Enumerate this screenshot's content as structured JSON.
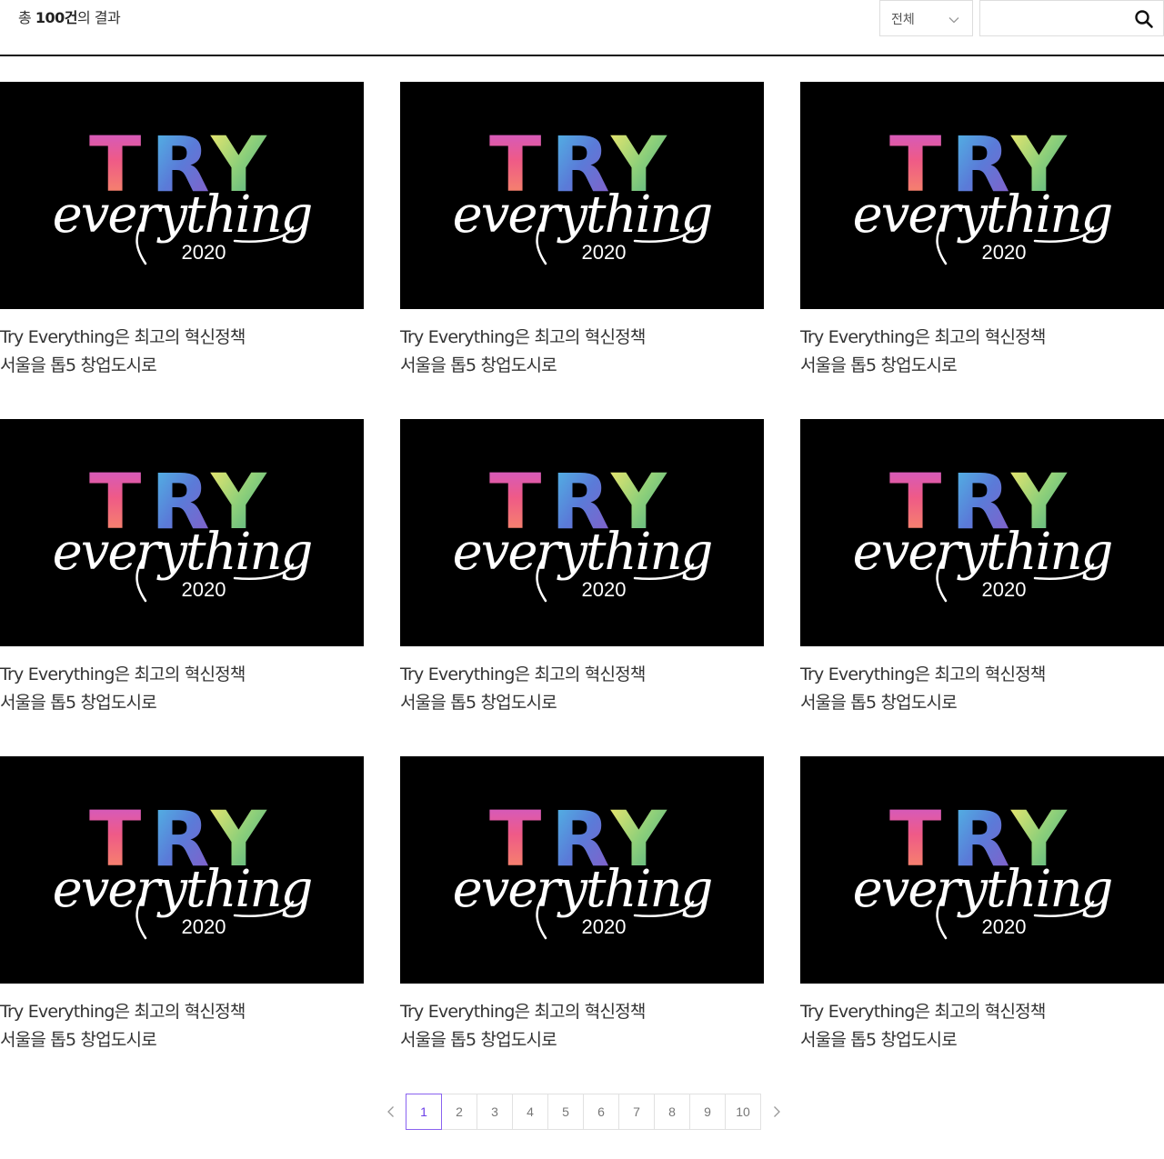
{
  "result": {
    "prefix": "총 ",
    "count": "100건",
    "suffix": "의 결과"
  },
  "filter": {
    "selected": "전체"
  },
  "search": {
    "placeholder": "",
    "value": ""
  },
  "thumbnail": {
    "top_word": "TRY",
    "script_word": "everything",
    "year": "2020"
  },
  "cards": [
    {
      "line1": "Try Everything은 최고의 혁신정책",
      "line2": "서울을 톱5 창업도시로"
    },
    {
      "line1": "Try Everything은 최고의 혁신정책",
      "line2": "서울을 톱5 창업도시로"
    },
    {
      "line1": "Try Everything은 최고의 혁신정책",
      "line2": "서울을 톱5 창업도시로"
    },
    {
      "line1": "Try Everything은 최고의 혁신정책",
      "line2": "서울을 톱5 창업도시로"
    },
    {
      "line1": "Try Everything은 최고의 혁신정책",
      "line2": "서울을 톱5 창업도시로"
    },
    {
      "line1": "Try Everything은 최고의 혁신정책",
      "line2": "서울을 톱5 창업도시로"
    },
    {
      "line1": "Try Everything은 최고의 혁신정책",
      "line2": "서울을 톱5 창업도시로"
    },
    {
      "line1": "Try Everything은 최고의 혁신정책",
      "line2": "서울을 톱5 창업도시로"
    },
    {
      "line1": "Try Everything은 최고의 혁신정책",
      "line2": "서울을 톱5 창업도시로"
    }
  ],
  "pagination": {
    "pages": [
      "1",
      "2",
      "3",
      "4",
      "5",
      "6",
      "7",
      "8",
      "9",
      "10"
    ],
    "current": "1"
  },
  "colors": {
    "accent": "#6c3fe8",
    "divider": "#111111",
    "thumb_bg": "#000000"
  },
  "icons": {
    "filter": "chevron-down-icon",
    "search": "search-icon",
    "prev": "chevron-left-icon",
    "next": "chevron-right-icon"
  }
}
